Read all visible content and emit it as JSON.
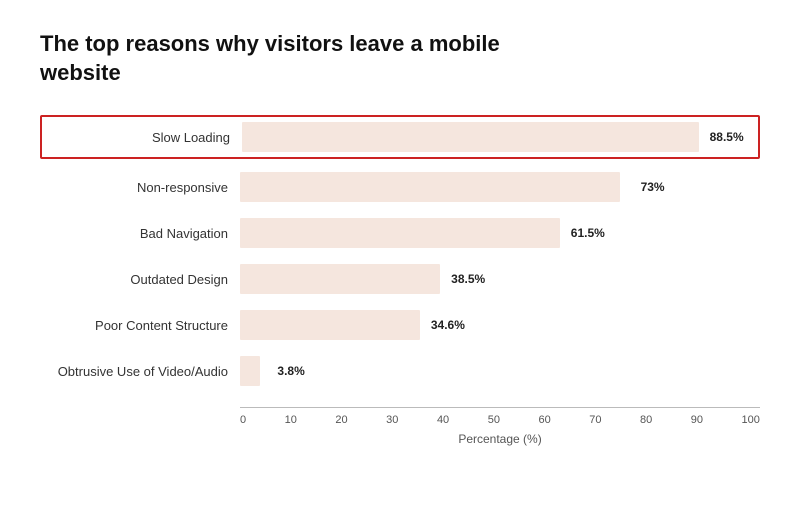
{
  "title": "The top reasons why visitors leave a mobile website",
  "bars": [
    {
      "label": "Slow Loading",
      "value": 88.5,
      "display": "88.5%",
      "highlighted": true
    },
    {
      "label": "Non-responsive",
      "value": 73,
      "display": "73%",
      "highlighted": false
    },
    {
      "label": "Bad Navigation",
      "value": 61.5,
      "display": "61.5%",
      "highlighted": false
    },
    {
      "label": "Outdated Design",
      "value": 38.5,
      "display": "38.5%",
      "highlighted": false
    },
    {
      "label": "Poor Content Structure",
      "value": 34.6,
      "display": "34.6%",
      "highlighted": false
    },
    {
      "label": "Obtrusive Use of Video/Audio",
      "value": 3.8,
      "display": "3.8%",
      "highlighted": false
    }
  ],
  "xAxis": {
    "ticks": [
      "0",
      "10",
      "20",
      "30",
      "40",
      "50",
      "60",
      "70",
      "80",
      "90",
      "100"
    ],
    "label": "Percentage (%)"
  },
  "colors": {
    "bar": "#f5e6de",
    "highlight_border": "#cc2222",
    "axis": "#999"
  }
}
